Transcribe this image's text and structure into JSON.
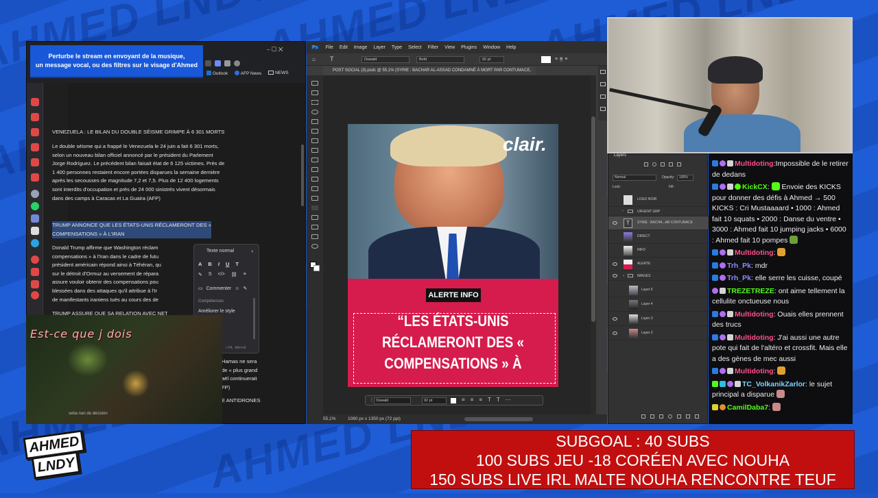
{
  "overlay": {
    "banner": {
      "line1": "Perturbe le stream en envoyant de la musique,",
      "line2": "un message vocal, ou des filtres sur le visage d'Ahmed"
    },
    "logo": {
      "line1": "AHMED",
      "line2": "LNDY"
    },
    "watermark": "AHMED LNDY",
    "subgoal": {
      "line1": "SUBGOAL : 40 SUBS",
      "line2": "100 SUBS JEU -18 CORÉEN AVEC NOUHA",
      "line3": "150 SUBS LIVE IRL MALTE NOUHA RENCONTRE TEUF"
    }
  },
  "browser": {
    "bookmarks": [
      "Outlook",
      "AFP News",
      "NEWS"
    ]
  },
  "doc": {
    "h1": "VENEZUELA : LE BILAN DU DOUBLE SÉISME GRIMPE À 6 301 MORTS",
    "p1": [
      "Le double séisme qui a frappé le Venezuela le 24 juin a fait 6 301 morts,",
      "selon un nouveau bilan officiel annoncé par le président du Parlement",
      "Jorge Rodríguez. Le précédent bilan faisait état de 6 125 victimes. Près de",
      "1 400 personnes restaient encore portées disparues la semaine dernière",
      "après les secousses de magnitude 7,2 et 7,5. Plus de 12 400 logements",
      "sont interdits d'occupation et près de 24 000 sinistrés vivent désormais",
      "dans des camps à Caracas et La Guaira (AFP)"
    ],
    "h2": [
      "TRUMP ANNONCE QUE LES ÉTATS-UNIS RÉCLAMERONT DES «",
      "COMPENSATIONS » À L'IRAN"
    ],
    "p2": [
      "Donald Trump affirme que Washington réclam",
      "compensations » à l'Iran dans le cadre de futu",
      "président américain répond ainsi à Téhéran, qu",
      "sur le détroit d'Ormuz au versement de répara",
      "assure vouloir obtenir des compensations pou",
      "blessées dans des attaques qu'il attribue à l'Ir",
      "de manifestants iraniens tués au cours des de"
    ],
    "h3": "TRUMP ASSURE QUE SA RELATION AVEC NETA",
    "p3": [
      "Hamas ne sera",
      "de « plus grand",
      "aël continuerait",
      "FP)"
    ],
    "h4": "E ANTIDRONES"
  },
  "context_menu": {
    "style": "Texte normal",
    "comment": "Commenter",
    "section": "Compétences",
    "action": "Améliorer le style",
    "footer1": "r l'IA",
    "footer2": "Alt+I+E"
  },
  "game": {
    "caption": "Est-ce que j dois",
    "subtitle": "seba nan de décision"
  },
  "photoshop": {
    "menu": [
      "Ps",
      "File",
      "Edit",
      "Image",
      "Layer",
      "Type",
      "Select",
      "Filter",
      "View",
      "Plugins",
      "Window",
      "Help"
    ],
    "font": "Oswald",
    "weight": "Bold",
    "size": "92 pt",
    "tab": "POST SOCIAL (3).psdc @ 55,1% (SYRIE : BACHAR AL-ASSAD CONDAMNÉ À MORT PAR CONTUMACE, RGB/8)",
    "zoom": "55,1%",
    "doc_size": "1080 px x 1350 px (72 ppi)",
    "ctx_font": "Oswald",
    "ctx_size": "92 pt"
  },
  "post": {
    "brand": "clair.",
    "tag": "ALERTE INFO",
    "headline": [
      "“LES ÉTATS-UNIS",
      "RÉCLAMERONT DES «",
      "COMPENSATIONS » À"
    ]
  },
  "layers": {
    "header": "Layers",
    "blend": "Normal",
    "opacity_label": "Opacity:",
    "opacity": "100%",
    "lock": "Lock:",
    "fill": "Fill:",
    "items": [
      "LOGO NOIR",
      "URGENT GRP",
      "SYRIE : BACHA...AR CONTUMACE",
      "DIRECT",
      "INFO",
      "ALERTE",
      "IMAGES",
      "Layer 5",
      "Layer 4",
      "Layer 3",
      "Layer 2"
    ]
  },
  "chat": [
    {
      "user": "Multidoting",
      "color": "#ff4f8b",
      "text": "Impossible de le retirer de dedans"
    },
    {
      "user": "KickCX",
      "color": "#53fc18",
      "text": "Envoie des KICKS pour donner des défis à Ahmed → 500 KICKS : Cri Mustaaaard • 1000 : Ahmed fait 10 squats • 2000 : Danse du ventre • 3000 : Ahmed fait 10 jumping jacks • 6000 : Ahmed fait 10 pompes"
    },
    {
      "user": "Multidoting",
      "color": "#ff4f8b",
      "text": ""
    },
    {
      "user": "Trh_Pk",
      "color": "#8b8bff",
      "text": "mdr"
    },
    {
      "user": "Trh_Pk",
      "color": "#8b8bff",
      "text": "elle serre les cuisse, coupé"
    },
    {
      "user": "TREZETREZE",
      "color": "#53fc18",
      "text": "ont aime tellement la cellulite onctueuse nous"
    },
    {
      "user": "Multidoting",
      "color": "#ff4f8b",
      "text": "Ouais elles prennent des trucs"
    },
    {
      "user": "Multidoting",
      "color": "#ff4f8b",
      "text": "J'ai aussi une autre pote qui fait de l'altéro et crossfit. Mais elle a des gènes de mec aussi"
    },
    {
      "user": "Multidoting",
      "color": "#ff4f8b",
      "text": ""
    },
    {
      "user": "TC_VolkanikZarlor",
      "color": "#7fd3ff",
      "text": "le sujet principal a disparue"
    },
    {
      "user": "CamilDaba7",
      "color": "#53fc18",
      "text": ""
    }
  ]
}
